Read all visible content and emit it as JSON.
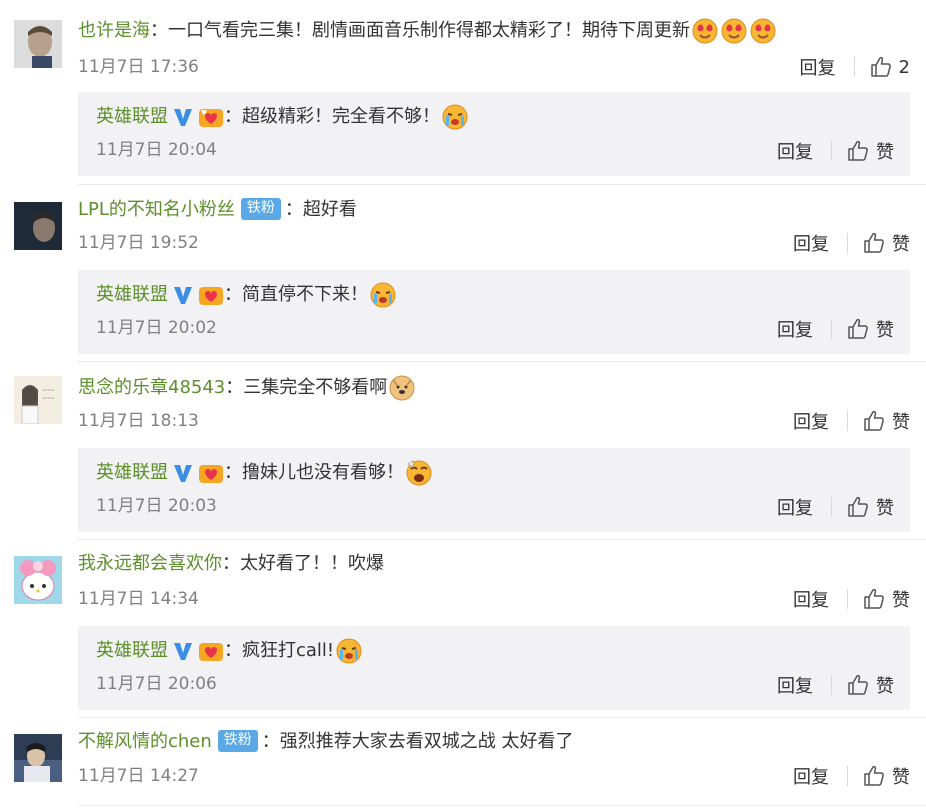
{
  "comments": [
    {
      "user": "也许是海",
      "text": "：一口气看完三集！剧情画面音乐制作得都太精彩了！期待下周更新",
      "time": "11月7日 17:36",
      "reply_label": "回复",
      "like_label": "2",
      "reply": {
        "user": "英雄联盟",
        "text": "：超级精彩！完全看不够！",
        "time": "11月7日 20:04",
        "reply_label": "回复",
        "like_label": "赞"
      }
    },
    {
      "user": "LPL的不知名小粉丝",
      "badge": "铁粉",
      "text": "：超好看",
      "time": "11月7日 19:52",
      "reply_label": "回复",
      "like_label": "赞",
      "reply": {
        "user": "英雄联盟",
        "text": "：简直停不下来！",
        "time": "11月7日 20:02",
        "reply_label": "回复",
        "like_label": "赞"
      }
    },
    {
      "user": "思念的乐章48543",
      "text": "：三集完全不够看啊",
      "time": "11月7日 18:13",
      "reply_label": "回复",
      "like_label": "赞",
      "reply": {
        "user": "英雄联盟",
        "text": "：撸妹儿也没有看够！",
        "time": "11月7日 20:03",
        "reply_label": "回复",
        "like_label": "赞"
      }
    },
    {
      "user": "我永远都会喜欢你",
      "text": "：太好看了！！吹爆",
      "time": "11月7日 14:34",
      "reply_label": "回复",
      "like_label": "赞",
      "reply": {
        "user": "英雄联盟",
        "text": "：疯狂打call!",
        "time": "11月7日 20:06",
        "reply_label": "回复",
        "like_label": "赞"
      }
    },
    {
      "user": "不解风情的chen",
      "badge": "铁粉",
      "text": "：强烈推荐大家去看双城之战 太好看了",
      "time": "11月7日 14:27",
      "reply_label": "回复",
      "like_label": "赞"
    }
  ],
  "colors": {
    "username": "#5d8f2b",
    "meta": "#808080",
    "reply_bg": "#f2f2f5",
    "badge": "#5aa9e6",
    "verified": "#3a8ee6"
  },
  "icons": [
    "thumbs-up-icon",
    "verified-v-icon",
    "vip-heart-icon",
    "heart-eyes-emoji",
    "crying-emoji",
    "doge-emoji",
    "surprised-emoji"
  ]
}
